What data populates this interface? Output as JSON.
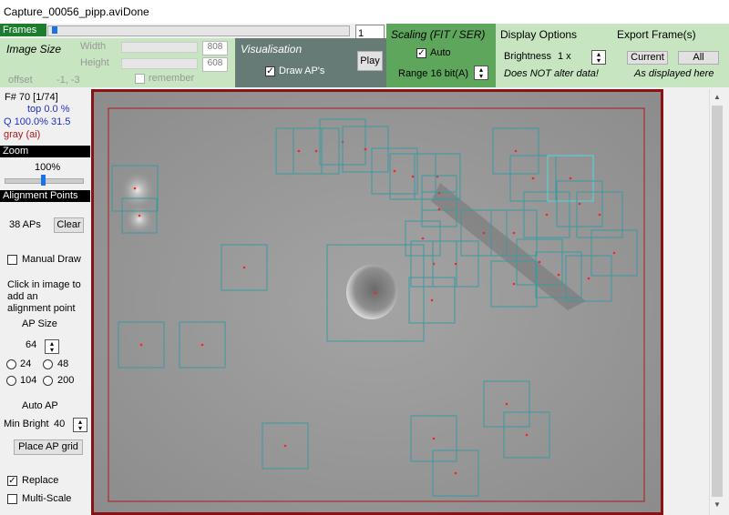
{
  "window": {
    "filename": "Capture_00056_pipp.avi",
    "status": "Done"
  },
  "frames": {
    "label": "Frames",
    "current": "1",
    "play": "Play",
    "position_fraction": 0.01
  },
  "image_size": {
    "title": "Image Size",
    "width_label": "Width",
    "width_value": "808",
    "height_label": "Height",
    "height_value": "608",
    "offset_label": "offset",
    "offset_value": "-1, -3",
    "remember_label": "remember"
  },
  "visualisation": {
    "title": "Visualisation",
    "draw_aps_label": "Draw AP's",
    "draw_aps_checked": true
  },
  "scaling": {
    "title": "Scaling (FIT / SER)",
    "auto_label": "Auto",
    "auto_checked": true,
    "range_label": "Range 16 bit(A)"
  },
  "display": {
    "title": "Display Options",
    "brightness_label": "Brightness",
    "brightness_value": "1 x",
    "note": "Does NOT alter data!"
  },
  "export": {
    "title": "Export Frame(s)",
    "current_label": "Current",
    "all_label": "All",
    "note": "As displayed here"
  },
  "info": {
    "frame": "F# 70 [1/74]",
    "top": "top 0.0 %",
    "quality": "Q 100.0%  31.5",
    "mode": "gray (ai)"
  },
  "zoom": {
    "title": "Zoom",
    "value": "100%",
    "level_fraction": 0.5
  },
  "alignment": {
    "title": "Alignment Points",
    "count": "38 APs",
    "clear": "Clear",
    "manual_draw": "Manual Draw",
    "hint": "Click in image to add an alignment point",
    "ap_size_label": "AP Size",
    "ap_size_value": "64",
    "sizes": [
      "24",
      "48",
      "104",
      "200"
    ],
    "auto_ap": "Auto AP",
    "min_bright_label": "Min Bright",
    "min_bright_value": "40",
    "place_grid": "Place AP grid",
    "replace": "Replace",
    "multi_scale": "Multi-Scale"
  },
  "colors": {
    "ap_box": "#3a9aa0",
    "ap_box_highlight": "#4fd8e0",
    "ap_dot": "#ff2020",
    "roi": "#b01818"
  }
}
